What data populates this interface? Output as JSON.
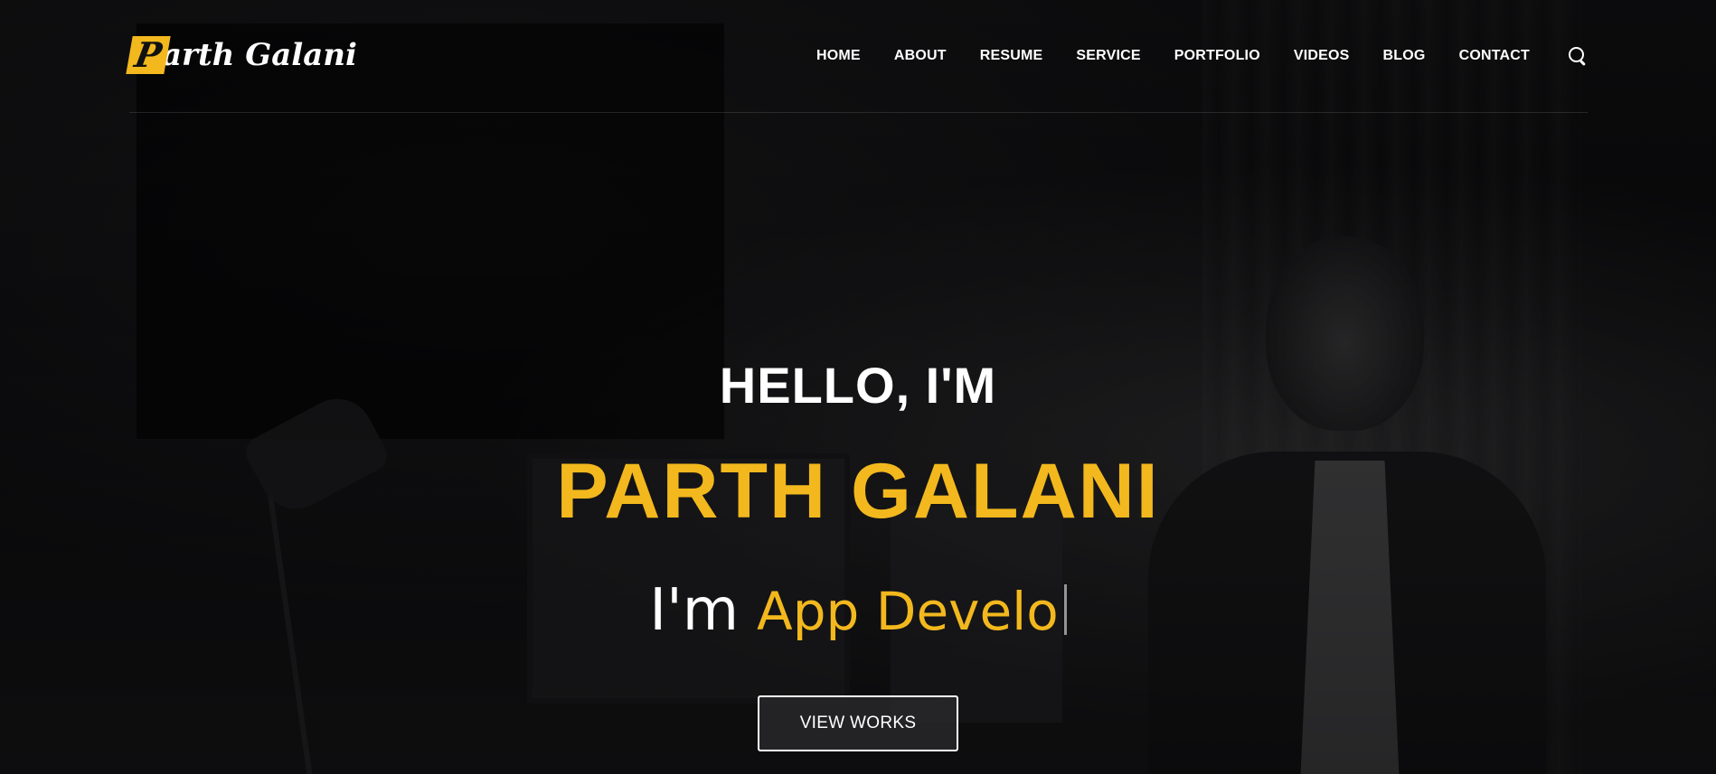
{
  "logo": {
    "mark": "P",
    "rest": "arth Galani",
    "accent_color": "#f2b81d"
  },
  "nav": {
    "items": [
      {
        "label": "HOME"
      },
      {
        "label": "ABOUT"
      },
      {
        "label": "RESUME"
      },
      {
        "label": "SERVICE"
      },
      {
        "label": "PORTFOLIO"
      },
      {
        "label": "VIDEOS"
      },
      {
        "label": "BLOG"
      },
      {
        "label": "CONTACT"
      }
    ],
    "search_icon": "search-icon"
  },
  "hero": {
    "greeting": "HELLO, I'M",
    "name": "PARTH GALANI",
    "typed_prefix": "I'm",
    "typed_text": "App Develo",
    "cta_label": "VIEW WORKS"
  },
  "colors": {
    "accent": "#f2b81d",
    "text": "#ffffff",
    "background": "#0b0b0c"
  }
}
